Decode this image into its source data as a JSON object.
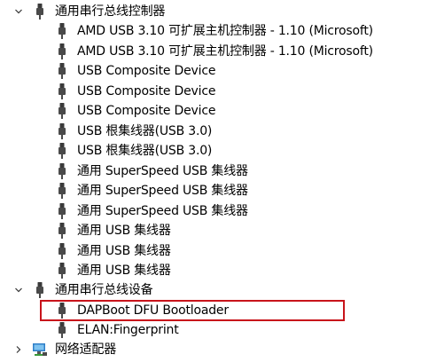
{
  "tree": {
    "category_usb_controllers": {
      "label": "通用串行总线控制器",
      "expanded": true,
      "icon": "usb-plug-icon",
      "children": [
        "AMD USB 3.10 可扩展主机控制器 - 1.10 (Microsoft)",
        "AMD USB 3.10 可扩展主机控制器 - 1.10 (Microsoft)",
        "USB Composite Device",
        "USB Composite Device",
        "USB Composite Device",
        "USB 根集线器(USB 3.0)",
        "USB 根集线器(USB 3.0)",
        "通用 SuperSpeed USB 集线器",
        "通用 SuperSpeed USB 集线器",
        "通用 SuperSpeed USB 集线器",
        "通用 USB 集线器",
        "通用 USB 集线器",
        "通用 USB 集线器"
      ]
    },
    "category_usb_devices": {
      "label": "通用串行总线设备",
      "expanded": true,
      "icon": "usb-plug-icon",
      "children": [
        "DAPBoot DFU Bootloader",
        "ELAN:Fingerprint"
      ]
    },
    "category_network_adapters": {
      "label": "网络适配器",
      "expanded": false,
      "icon": "network-adapter-icon"
    }
  },
  "highlight": {
    "outline_color": "#c8141b",
    "selected_item": "DAPBoot DFU Bootloader"
  }
}
